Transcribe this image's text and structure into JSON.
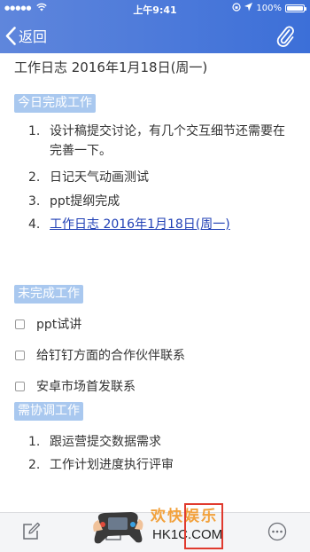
{
  "status_bar": {
    "signal": "●●●●●",
    "time": "上午9:41",
    "battery_percent": "100%"
  },
  "nav": {
    "back_label": "返回",
    "back_icon": "chevron-left-icon",
    "attach_icon": "paperclip-icon"
  },
  "doc": {
    "title": "工作日志 2016年1月18日(周一)",
    "sections": [
      {
        "label": "今日完成工作",
        "items": [
          {
            "num": "1.",
            "text": "设计稿提交讨论，有几个交互细节还需要在完善一下。"
          },
          {
            "num": "2.",
            "text": "日记天气动画测试"
          },
          {
            "num": "3.",
            "text": "ppt提纲完成"
          },
          {
            "num": "4.",
            "text": "工作日志 2016年1月18日(周一)"
          }
        ]
      },
      {
        "label": "未完成工作",
        "items": [
          {
            "text": "ppt试讲",
            "checked": false
          },
          {
            "text": "给钉钉方面的合作伙伴联系",
            "checked": false
          },
          {
            "text": "安卓市场首发联系",
            "checked": false
          }
        ]
      },
      {
        "label": "需协调工作",
        "items": [
          {
            "num": "1.",
            "text": "跟运营提交数据需求"
          },
          {
            "num": "2.",
            "text": "工作计划进度执行评审"
          }
        ]
      }
    ]
  },
  "toolbar": {
    "edit_icon": "edit-icon",
    "share_icon": "share-icon",
    "more_icon": "more-icon"
  },
  "watermark": {
    "line1": "欢快娱乐",
    "line2": "HK1C.COM"
  },
  "colors": {
    "nav_blue": "#3c6fd8",
    "tag_bg": "#a9c8ef",
    "link": "#1f3fb5"
  }
}
